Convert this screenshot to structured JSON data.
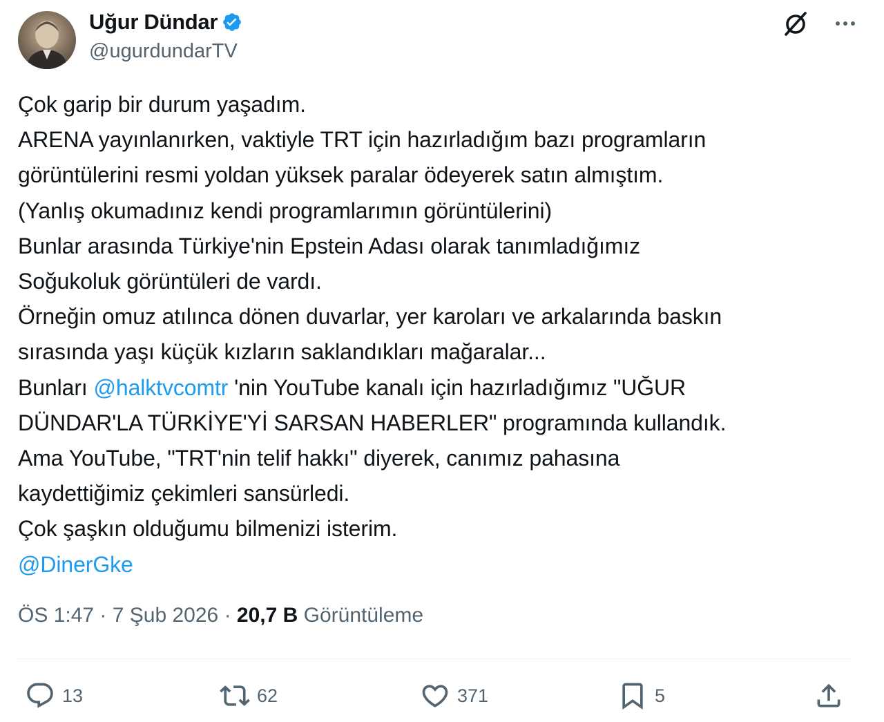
{
  "author": {
    "display_name": "Uğur Dündar",
    "handle": "@ugurdundarTV",
    "verified_color": "#1d9bf0"
  },
  "icons": {
    "grok": "grok-icon",
    "more": "more-icon",
    "verified": "verified-badge-icon",
    "reply": "reply-icon",
    "retweet": "retweet-icon",
    "like": "heart-icon",
    "bookmark": "bookmark-icon",
    "share": "share-icon"
  },
  "tweet": {
    "lines": [
      "Çok garip bir durum yaşadım.",
      "ARENA yayınlanırken, vaktiyle TRT için hazırladığım bazı programların",
      "görüntülerini resmi yoldan yüksek paralar ödeyerek satın almıştım.",
      "(Yanlış okumadınız kendi programlarımın görüntülerini)",
      "Bunlar arasında Türkiye'nin Epstein Adası olarak tanımladığımız",
      "Soğukoluk görüntüleri de vardı.",
      "Örneğin omuz atılınca dönen duvarlar, yer karoları ve arkalarında baskın",
      "sırasında yaşı küçük kızların saklandıkları mağaralar..."
    ],
    "line9_prefix": "Bunları ",
    "line9_mention": "@halktvcomtr",
    "line9_suffix": " 'nin YouTube kanalı için hazırladığımız \"UĞUR",
    "lines_after": [
      "DÜNDAR'LA TÜRKİYE'Yİ SARSAN HABERLER\" programında kullandık.",
      "Ama YouTube, \"TRT'nin telif hakkı\" diyerek, canımız pahasına",
      "kaydettiğimiz çekimleri sansürledi.",
      "Çok şaşkın olduğumu bilmenizi isterim."
    ],
    "final_mention": "@DinerGke",
    "mention_color": "#1d9bf0"
  },
  "meta": {
    "time": "ÖS 1:47",
    "separator": " · ",
    "date": "7 Şub 2026",
    "views_count": "20,7 B",
    "views_label": " Görüntüleme"
  },
  "actions": {
    "replies": "13",
    "reposts": "62",
    "likes": "371",
    "bookmarks": "5"
  }
}
